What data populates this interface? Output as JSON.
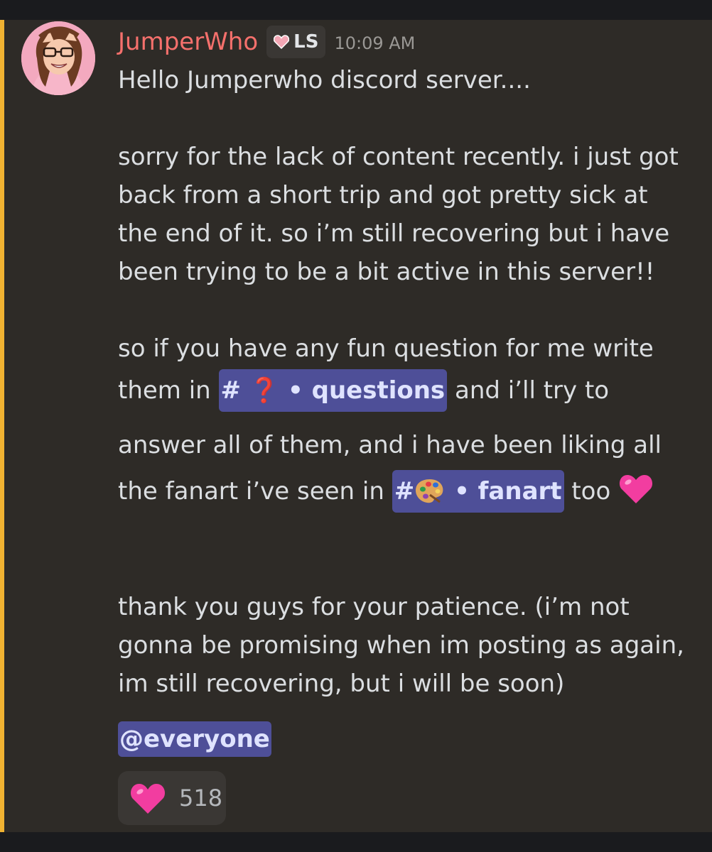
{
  "message": {
    "username": "JumperWho",
    "tag_label": "LS",
    "timestamp": "10:09 AM",
    "lines": {
      "l1": "Hello Jumperwho discord server....",
      "l2": "sorry for the lack of content recently. i just got",
      "l3": "back from a short trip and got pretty sick at",
      "l4": "the end of it. so i’m still recovering but i have",
      "l5": "been trying to be a bit active in this server!!",
      "l6": "so if you have any fun question for me write",
      "l7_pre": "them in ",
      "l7_post": " and i’ll try to",
      "l8": "answer all of them, and i have been liking all",
      "l9_pre": "the fanart i’ve seen in ",
      "l9_post": " too ",
      "l10": "thank you guys for your patience. (i’m not",
      "l11": "gonna be promising when im posting as again,",
      "l12": "im still recovering, but i will be soon)"
    },
    "channels": {
      "questions": {
        "hash": "#",
        "emoji": "❓",
        "sep": " • ",
        "name": "questions"
      },
      "fanart": {
        "hash": "#",
        "sep": " • ",
        "name": "fanart"
      }
    },
    "mention": "@everyone",
    "reaction": {
      "emoji": "pink-heart",
      "count": "518"
    }
  },
  "colors": {
    "username": "#f5706c",
    "mention_bar": "#f0b232",
    "channel_chip": "#4e4f98",
    "background": "#2e2b27"
  }
}
